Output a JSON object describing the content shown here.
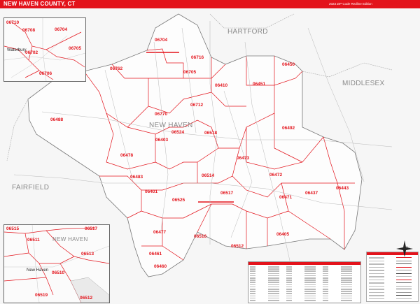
{
  "header": {
    "title": "NEW HAVEN COUNTY, CT",
    "edition": "2023 ZIP Code Redline Edition",
    "logo_top": "Digital",
    "logo_bottom": "MAPS"
  },
  "regions": {
    "hartford": "HARTFORD",
    "middlesex": "MIDDLESEX",
    "fairfield": "FAIRFIELD",
    "new_haven": "NEW HAVEN"
  },
  "zips": {
    "z06704": "06704",
    "z06716": "06716",
    "z06705": "06705",
    "z06762": "06762",
    "z06410": "06410",
    "z06451": "06451",
    "z06450": "06450",
    "z06712": "06712",
    "z06770": "06770",
    "z06488": "06488",
    "z06524": "06524",
    "z06518": "06518",
    "z06492": "06492",
    "z06403": "06403",
    "z06478": "06478",
    "z06473": "06473",
    "z06483": "06483",
    "z06514": "06514",
    "z06472": "06472",
    "z06443": "06443",
    "z06437": "06437",
    "z06401": "06401",
    "z06517": "06517",
    "z06525": "06525",
    "z06471": "06471",
    "z06477": "06477",
    "z06516": "06516",
    "z06512": "06512",
    "z06405": "06405",
    "z06461": "06461",
    "z06460": "06460"
  },
  "inset_waterbury": {
    "place": "Waterbury",
    "zips": [
      "06710",
      "06704",
      "06705",
      "06708",
      "06702",
      "06706"
    ]
  },
  "inset_new_haven": {
    "place": "New Haven",
    "region": "NEW HAVEN",
    "zips": [
      "06515",
      "06517",
      "06511",
      "06513",
      "06510",
      "06519",
      "06512"
    ]
  },
  "legend": {
    "city_label": "City"
  }
}
